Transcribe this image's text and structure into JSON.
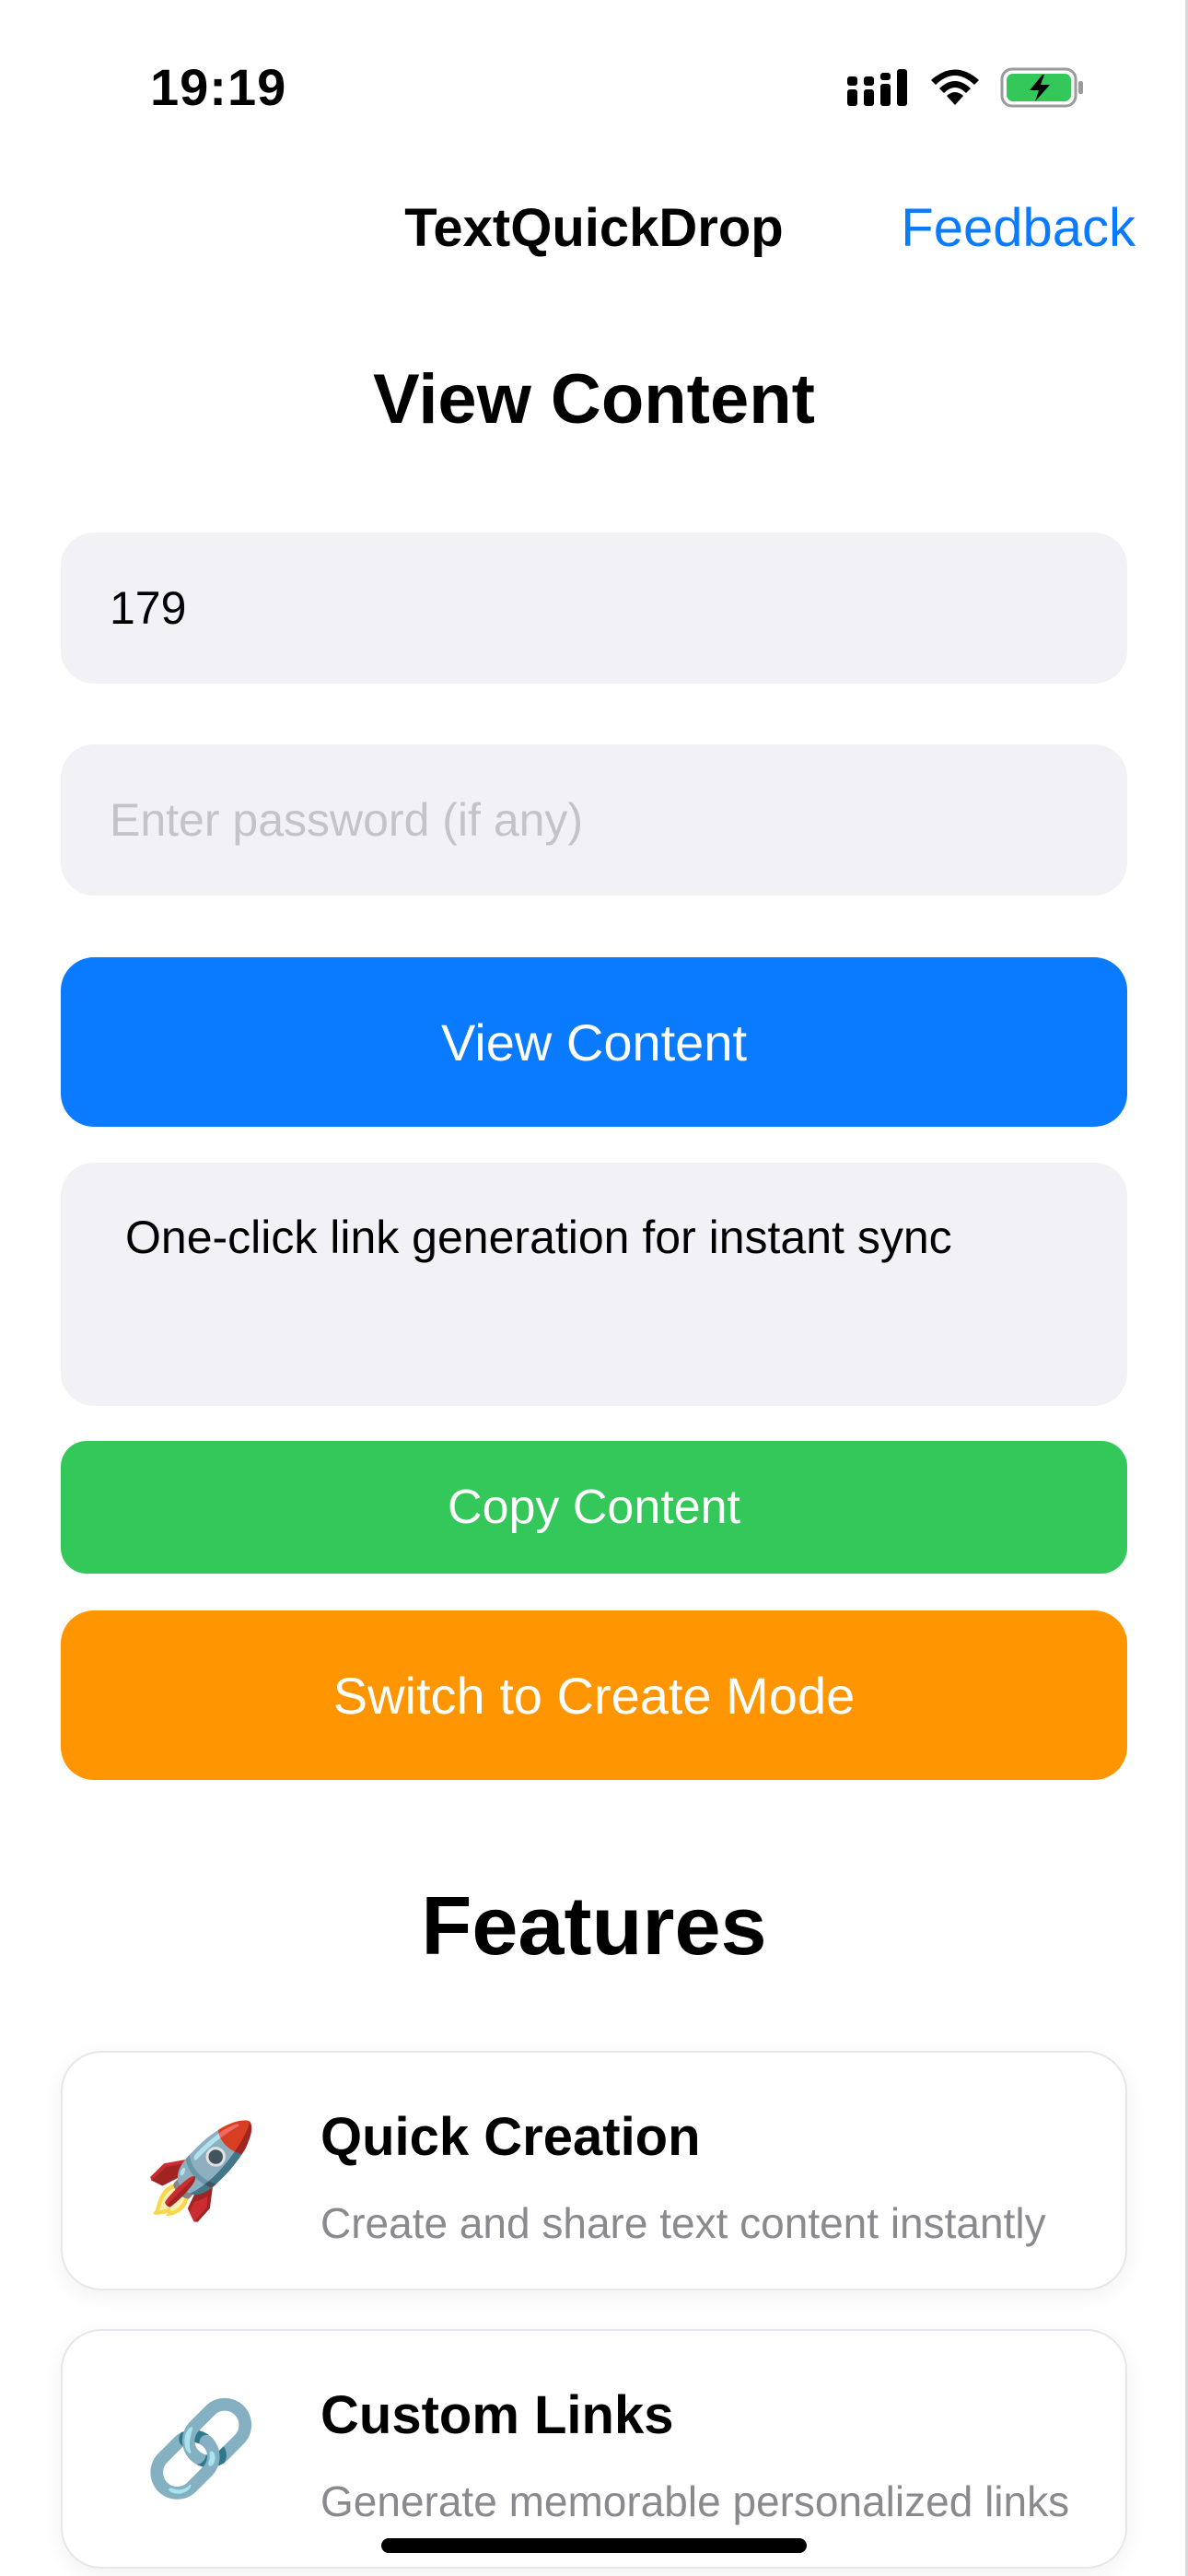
{
  "status_bar": {
    "time": "19:19",
    "icons": [
      "cellular-signal-icon",
      "wifi-icon",
      "battery-charging-icon"
    ],
    "battery_color": "#34c759"
  },
  "nav": {
    "title": "TextQuickDrop",
    "feedback_label": "Feedback"
  },
  "view": {
    "title": "View Content",
    "code_value": "179",
    "password_placeholder": "Enter password (if any)",
    "view_button_label": "View Content",
    "content_text": "One-click link generation for instant sync",
    "copy_button_label": "Copy Content",
    "switch_button_label": "Switch to Create Mode"
  },
  "features": {
    "title": "Features",
    "items": [
      {
        "icon": "rocket-icon",
        "emoji": "🚀",
        "title": "Quick Creation",
        "description": "Create and share text content instantly"
      },
      {
        "icon": "link-icon",
        "emoji": "🔗",
        "title": "Custom Links",
        "description": "Generate memorable personalized links"
      }
    ]
  },
  "colors": {
    "accent_blue": "#0a7aff",
    "copy_green": "#34c75a",
    "switch_orange": "#ff9500",
    "field_background": "#f1f1f6"
  }
}
